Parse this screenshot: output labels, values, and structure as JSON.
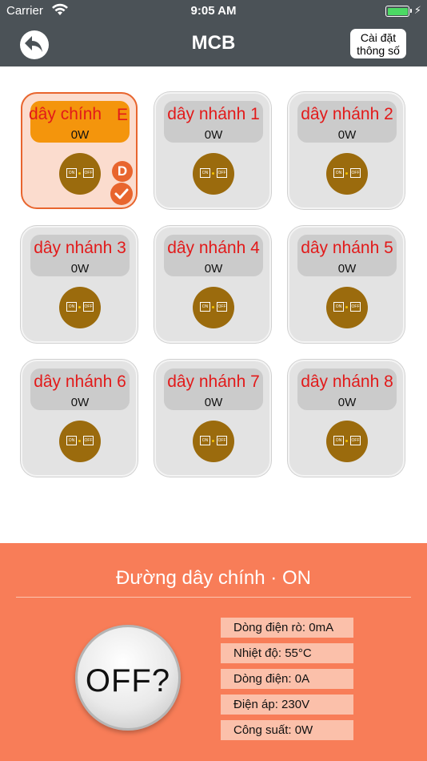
{
  "status": {
    "carrier": "Carrier",
    "time": "9:05 AM",
    "battery_color": "#4cd964"
  },
  "nav": {
    "title": "MCB",
    "settings_line1": "Cài đặt",
    "settings_line2": "thông số",
    "back_icon": "back-arrow-icon"
  },
  "tiles": [
    {
      "name": "dây chính",
      "power": "0W",
      "selected": true,
      "edge_letter": "E",
      "badge_d": "D"
    },
    {
      "name": "dây nhánh 1",
      "power": "0W"
    },
    {
      "name": "dây nhánh 2",
      "power": "0W"
    },
    {
      "name": "dây nhánh 3",
      "power": "0W"
    },
    {
      "name": "dây nhánh 4",
      "power": "0W"
    },
    {
      "name": "dây nhánh 5",
      "power": "0W"
    },
    {
      "name": "dây nhánh 6",
      "power": "0W"
    },
    {
      "name": "dây nhánh 7",
      "power": "0W"
    },
    {
      "name": "dây nhánh 8",
      "power": "0W"
    }
  ],
  "switch_labels": {
    "on": "ON",
    "off": "OFF"
  },
  "panel": {
    "line_status": "Đường dây chính · ON",
    "off_button": "OFF?",
    "readings": [
      "Dòng điện rò:  0mA",
      "Nhiệt độ:  55°C",
      "Dòng điện:  0A",
      "Điện áp:  230V",
      "Công suất:  0W"
    ]
  },
  "colors": {
    "accent": "#e8652e",
    "panel": "#f87d58",
    "nav": "#4b5257",
    "tile_name": "#e21a1a",
    "switch": "#9b6b0d"
  }
}
